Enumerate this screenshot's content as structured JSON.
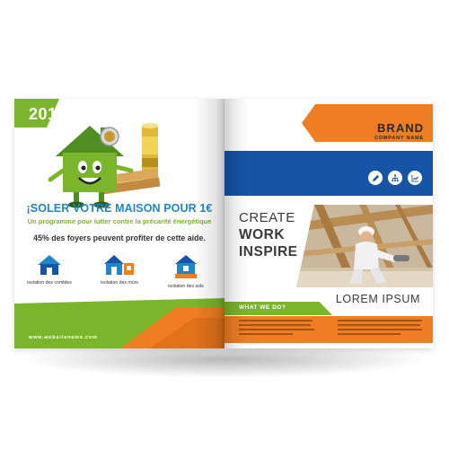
{
  "colors": {
    "green": "#7ab52b",
    "blue": "#1f87c9",
    "navy": "#1654a6",
    "orange": "#ef7d22",
    "dark_text": "#3a3a3a"
  },
  "left_page": {
    "year": "201",
    "headline": "¡SOLER VOTRE MAISON POUR 1€",
    "subline": "Un programme pour lutter contre la précarité énergétique",
    "stat": "45% des foyers peuvent profiter de cette aide.",
    "features": [
      {
        "icon": "house-roof-icon",
        "label": "isolation des combles"
      },
      {
        "icon": "house-walls-icon",
        "label": "isolation des murs"
      },
      {
        "icon": "house-floor-icon",
        "label": "isolation des sols"
      }
    ],
    "website": "www.websitename.com"
  },
  "right_page": {
    "brand": "BRAND",
    "company": "COMPANY NAME",
    "buttons": [
      {
        "icon": "pencil-icon"
      },
      {
        "icon": "network-icon"
      },
      {
        "icon": "chart-icon"
      }
    ],
    "slogan": {
      "line1": "CREATE",
      "line2": "WORK",
      "line3": "INSPIRE"
    },
    "lorem": "LOREM IPSUM",
    "what_we_do": "WHAT WE DO?"
  }
}
